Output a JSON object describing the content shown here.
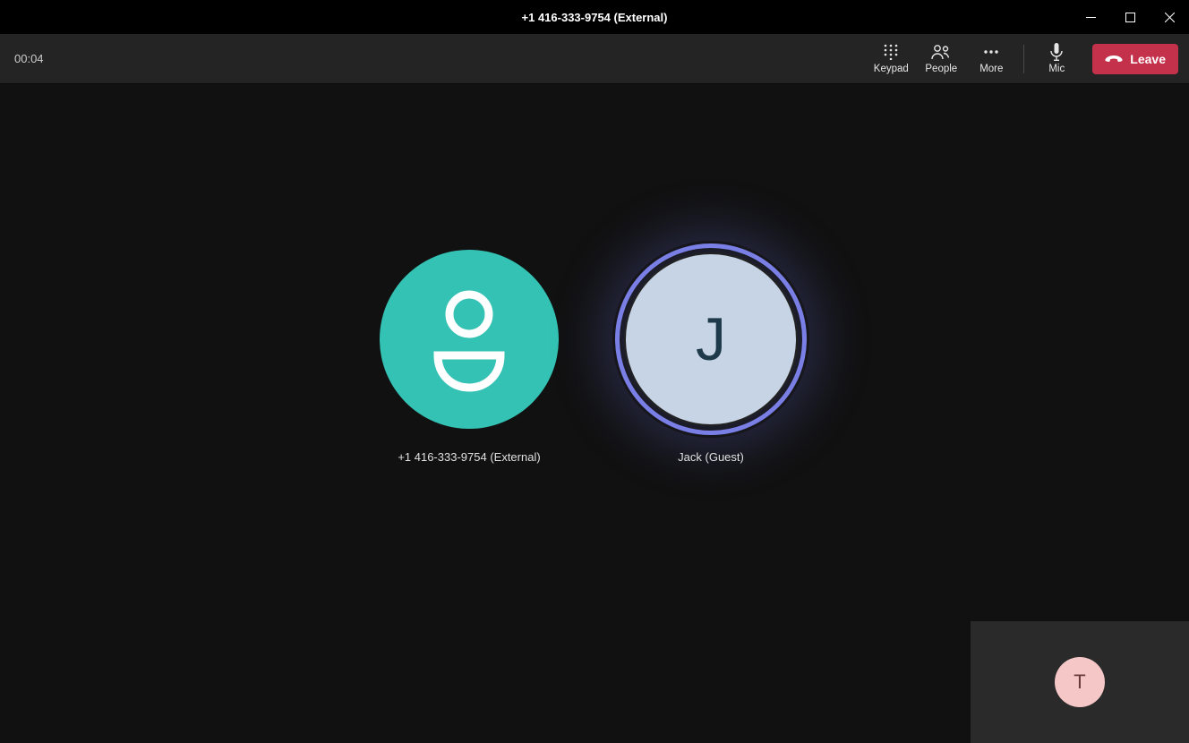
{
  "titlebar": {
    "title": "+1 416-333-9754 (External)"
  },
  "toolbar": {
    "timer": "00:04",
    "keypad_label": "Keypad",
    "people_label": "People",
    "more_label": "More",
    "mic_label": "Mic",
    "leave_label": "Leave"
  },
  "participants": {
    "external": {
      "name": "+1 416-333-9754 (External)"
    },
    "guest": {
      "name": "Jack (Guest)",
      "initial": "J"
    }
  },
  "selfview": {
    "initial": "T"
  },
  "colors": {
    "teal": "#33c2b3",
    "ring": "#7a7fe6",
    "leave": "#c4314b",
    "self_bg": "#f5c7c6"
  }
}
